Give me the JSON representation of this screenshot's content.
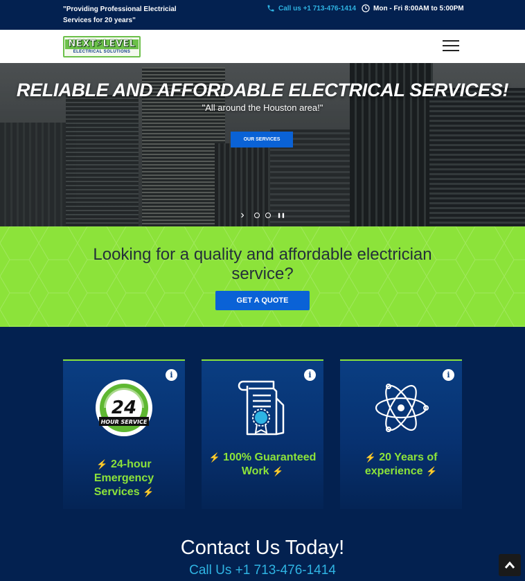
{
  "topbar": {
    "tagline": "\"Providing Professional Electricial Services for 20 years\"",
    "phone": "Call us +1 713-476-1414",
    "hours": "Mon - Fri 8:00AM to 5:00PM"
  },
  "header": {
    "logo_main": "NEXT⚡LEVEL",
    "logo_sub": "ELECTRICAL SOLUTIONS"
  },
  "hero": {
    "title": "RELIABLE AND AFFORDABLE ELECTRICAL SERVICES!",
    "subtitle": "\"All around the Houston area!\"",
    "button": "OUR SERVICES",
    "next_arrow": "›",
    "pause": "❚❚"
  },
  "cta": {
    "text": "Looking for a quality and affordable electrician service?",
    "button": "GET A QUOTE"
  },
  "cards": [
    {
      "label": "24-hour Emergency Services",
      "icon": "24-hour-service-icon",
      "info": "i",
      "badge_number": "24",
      "badge_text": "HOUR SERVICE"
    },
    {
      "label": "100% Guaranteed Work",
      "icon": "certificate-icon",
      "info": "i"
    },
    {
      "label": "20 Years of experience",
      "icon": "atom-icon",
      "info": "i"
    }
  ],
  "contact": {
    "title": "Contact Us Today!",
    "phone": "Call Us +1 713-476-1414"
  },
  "colors": {
    "navy": "#032150",
    "green": "#8ce33a",
    "blue_button": "#0a62d6",
    "cyan_text": "#2fb4e3",
    "bolt_yellow": "#f5d400"
  }
}
